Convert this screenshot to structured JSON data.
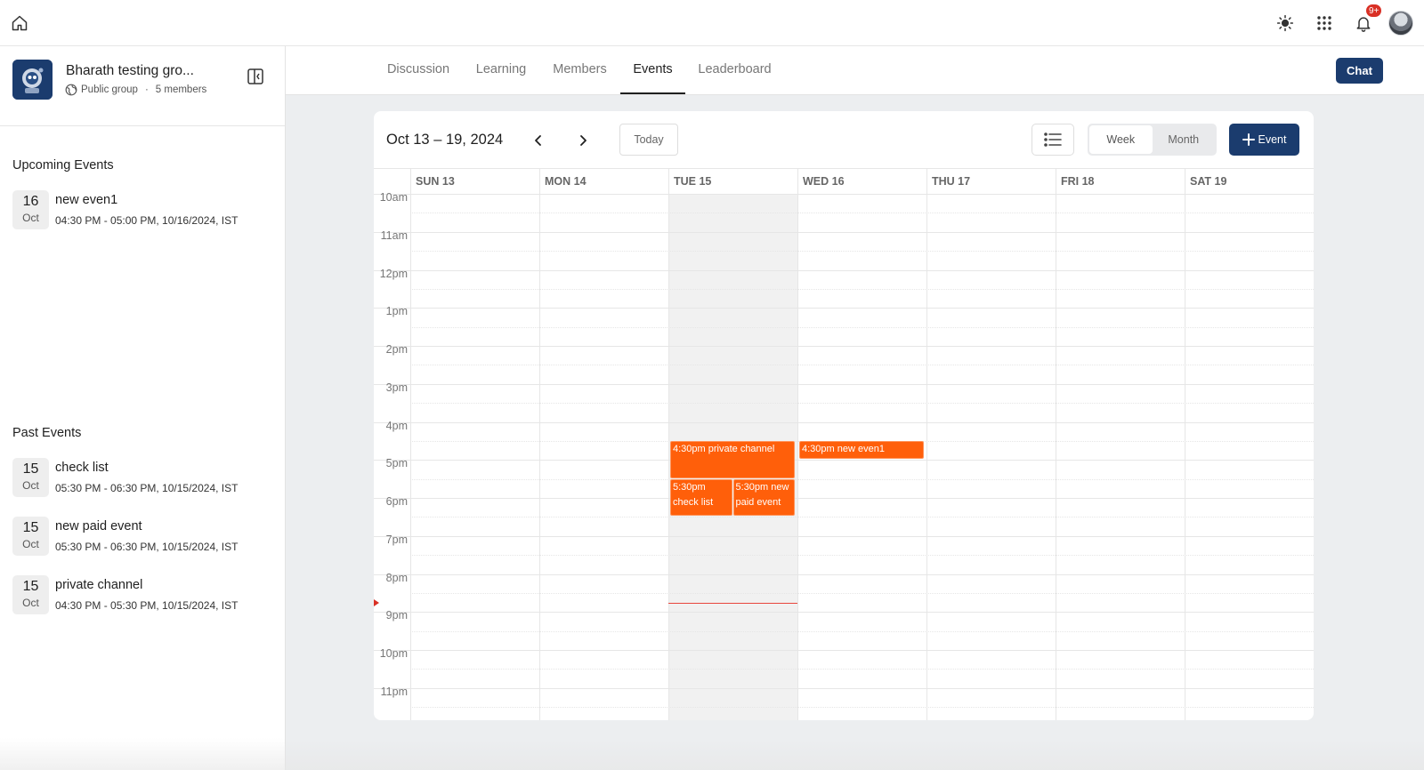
{
  "topbar": {
    "icons": [
      "home-icon",
      "sun-icon",
      "apps-grid-icon",
      "bell-icon"
    ],
    "notification_badge": "9+"
  },
  "group": {
    "name": "Bharath testing gro...",
    "visibility": "Public group",
    "separator": "·",
    "members": "5 members"
  },
  "sidebar": {
    "upcoming_title": "Upcoming Events",
    "upcoming": [
      {
        "day": "16",
        "month": "Oct",
        "title": "new even1",
        "time": "04:30 PM - 05:00 PM, 10/16/2024, IST"
      }
    ],
    "past_title": "Past Events",
    "past": [
      {
        "day": "15",
        "month": "Oct",
        "title": "check list",
        "time": "05:30 PM - 06:30 PM, 10/15/2024, IST"
      },
      {
        "day": "15",
        "month": "Oct",
        "title": "new paid event",
        "time": "05:30 PM - 06:30 PM, 10/15/2024, IST"
      },
      {
        "day": "15",
        "month": "Oct",
        "title": "private channel",
        "time": "04:30 PM - 05:30 PM, 10/15/2024, IST"
      }
    ]
  },
  "tabs": [
    "Discussion",
    "Learning",
    "Members",
    "Events",
    "Leaderboard"
  ],
  "active_tab": "Events",
  "chat_label": "Chat",
  "calendar": {
    "range_title": "Oct 13 – 19, 2024",
    "today_label": "Today",
    "view_week": "Week",
    "view_month": "Month",
    "active_view": "Week",
    "add_event_label": "Event",
    "days": [
      "SUN 13",
      "MON 14",
      "TUE 15",
      "WED 16",
      "THU 17",
      "FRI 18",
      "SAT 19"
    ],
    "today_index": 2,
    "hours": [
      "10am",
      "11am",
      "12pm",
      "1pm",
      "2pm",
      "3pm",
      "4pm",
      "5pm",
      "6pm",
      "7pm",
      "8pm",
      "9pm",
      "10pm",
      "11pm"
    ],
    "first_hour": 10,
    "now_time": 20.75,
    "events": [
      {
        "label": "4:30pm private channel",
        "day": 2,
        "start": 16.5,
        "end": 17.5,
        "lane": 0,
        "lanes": 1
      },
      {
        "label": "4:30pm new even1",
        "day": 3,
        "start": 16.5,
        "end": 17.0,
        "lane": 0,
        "lanes": 1
      },
      {
        "label": "5:30pm check list",
        "day": 2,
        "start": 17.5,
        "end": 18.5,
        "lane": 0,
        "lanes": 2
      },
      {
        "label": "5:30pm new paid event",
        "day": 2,
        "start": 17.5,
        "end": 18.5,
        "lane": 1,
        "lanes": 2
      }
    ],
    "event_color": "#ff5f0a"
  },
  "colors": {
    "primary": "#1b3c6e",
    "event": "#ff5f0a",
    "now_line": "#e8453c",
    "badge": "#d93025"
  }
}
